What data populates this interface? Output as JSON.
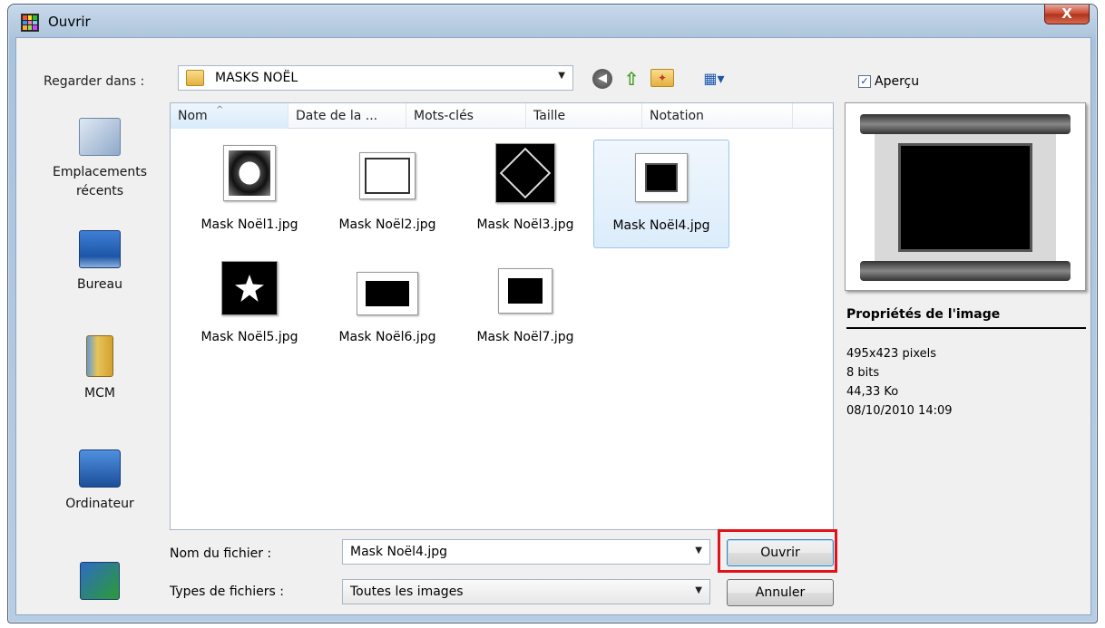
{
  "window": {
    "title": "Ouvrir",
    "close_label": "X"
  },
  "toolbar": {
    "lookin_label": "Regarder dans :",
    "lookin_value": "MASKS NOËL",
    "preview_checkbox_label": "Aperçu",
    "preview_checked": true
  },
  "places": [
    {
      "label": "Emplacements\nrécents",
      "icon": "recent-places-icon"
    },
    {
      "label": "Bureau",
      "icon": "desktop-icon"
    },
    {
      "label": "MCM",
      "icon": "folder-icon"
    },
    {
      "label": "Ordinateur",
      "icon": "computer-icon"
    },
    {
      "label": "",
      "icon": "network-icon"
    }
  ],
  "list": {
    "columns": [
      "Nom",
      "Date de la ...",
      "Mots-clés",
      "Taille",
      "Notation"
    ],
    "files": [
      {
        "name": "Mask Noël1.jpg"
      },
      {
        "name": "Mask Noël2.jpg"
      },
      {
        "name": "Mask Noël3.jpg"
      },
      {
        "name": "Mask Noël4.jpg",
        "selected": true
      },
      {
        "name": "Mask Noël5.jpg"
      },
      {
        "name": "Mask Noël6.jpg"
      },
      {
        "name": "Mask Noël7.jpg"
      }
    ]
  },
  "form": {
    "filename_label": "Nom du fichier :",
    "filename_value": "Mask Noël4.jpg",
    "filetype_label": "Types de fichiers :",
    "filetype_value": "Toutes les images",
    "open_label": "Ouvrir",
    "cancel_label": "Annuler"
  },
  "properties": {
    "title": "Propriétés de l'image",
    "dimensions": "495x423 pixels",
    "bits": "8 bits",
    "size": "44,33 Ko",
    "date": "08/10/2010 14:09"
  },
  "colors": {
    "highlight": "#e0121a",
    "selection": "#dcecfb"
  }
}
